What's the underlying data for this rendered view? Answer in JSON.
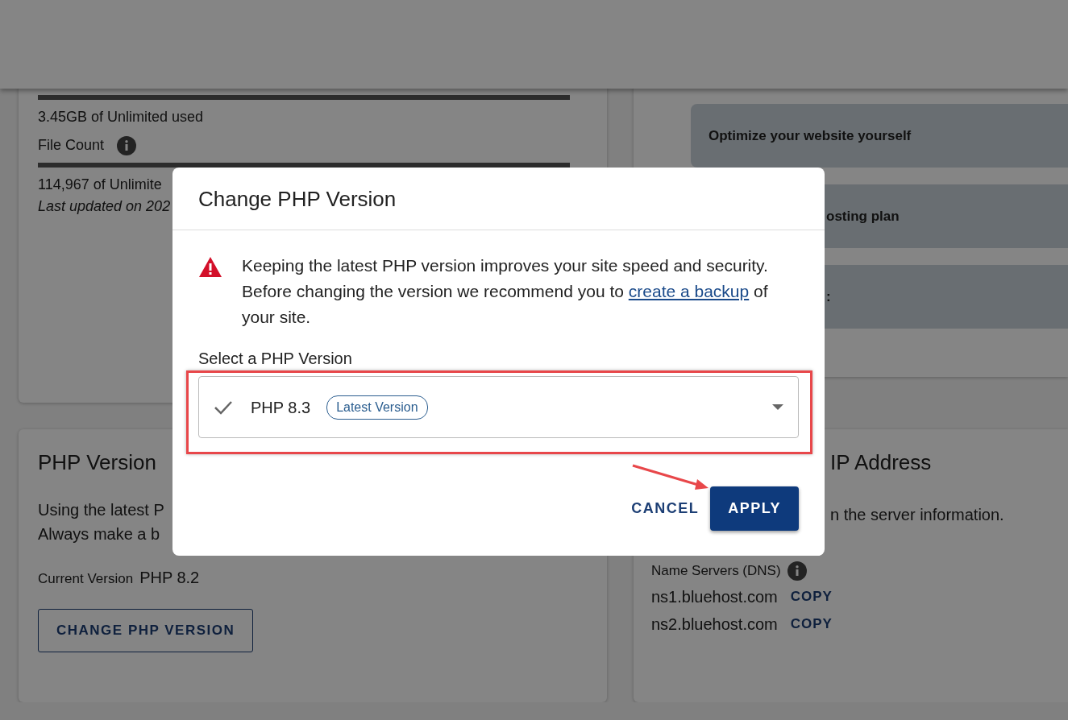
{
  "storage_card": {
    "disk_usage": "3.45GB of Unlimited used",
    "file_count_label": "File Count",
    "file_count_usage": "114,967 of Unlimite",
    "last_updated": "Last updated on 202"
  },
  "help_card": {
    "tiles": [
      "Optimize your website yourself",
      "osting plan",
      ":"
    ]
  },
  "php_card": {
    "title": "PHP Version",
    "description_lines": [
      "Using the latest P",
      "Always make a b"
    ],
    "current_label": "Current Version",
    "current_value": "PHP 8.2",
    "button": "CHANGE PHP VERSION"
  },
  "server_card": {
    "title": "IP Address",
    "description": "n the server information.",
    "dns_label": "Name Servers (DNS)",
    "name_servers": [
      {
        "host": "ns1.bluehost.com",
        "action": "COPY"
      },
      {
        "host": "ns2.bluehost.com",
        "action": "COPY"
      }
    ]
  },
  "dialog": {
    "title": "Change PHP Version",
    "message_before": "Keeping the latest PHP version improves your site speed and security. Before changing the version we recommend you to ",
    "link": "create a backup",
    "message_after": " of your site.",
    "select_label": "Select a PHP Version",
    "select": {
      "value": "PHP 8.3",
      "badge": "Latest Version",
      "checked": true
    },
    "buttons": [
      {
        "label": "CANCEL",
        "kind": "text"
      },
      {
        "label": "APPLY",
        "kind": "primary"
      }
    ]
  }
}
